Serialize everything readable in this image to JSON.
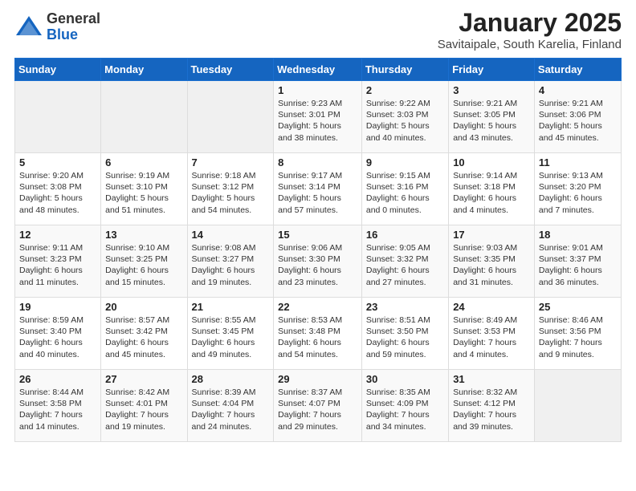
{
  "logo": {
    "general": "General",
    "blue": "Blue"
  },
  "header": {
    "title": "January 2025",
    "subtitle": "Savitaipale, South Karelia, Finland"
  },
  "weekdays": [
    "Sunday",
    "Monday",
    "Tuesday",
    "Wednesday",
    "Thursday",
    "Friday",
    "Saturday"
  ],
  "weeks": [
    [
      {
        "day": "",
        "info": ""
      },
      {
        "day": "",
        "info": ""
      },
      {
        "day": "",
        "info": ""
      },
      {
        "day": "1",
        "info": "Sunrise: 9:23 AM\nSunset: 3:01 PM\nDaylight: 5 hours and 38 minutes."
      },
      {
        "day": "2",
        "info": "Sunrise: 9:22 AM\nSunset: 3:03 PM\nDaylight: 5 hours and 40 minutes."
      },
      {
        "day": "3",
        "info": "Sunrise: 9:21 AM\nSunset: 3:05 PM\nDaylight: 5 hours and 43 minutes."
      },
      {
        "day": "4",
        "info": "Sunrise: 9:21 AM\nSunset: 3:06 PM\nDaylight: 5 hours and 45 minutes."
      }
    ],
    [
      {
        "day": "5",
        "info": "Sunrise: 9:20 AM\nSunset: 3:08 PM\nDaylight: 5 hours and 48 minutes."
      },
      {
        "day": "6",
        "info": "Sunrise: 9:19 AM\nSunset: 3:10 PM\nDaylight: 5 hours and 51 minutes."
      },
      {
        "day": "7",
        "info": "Sunrise: 9:18 AM\nSunset: 3:12 PM\nDaylight: 5 hours and 54 minutes."
      },
      {
        "day": "8",
        "info": "Sunrise: 9:17 AM\nSunset: 3:14 PM\nDaylight: 5 hours and 57 minutes."
      },
      {
        "day": "9",
        "info": "Sunrise: 9:15 AM\nSunset: 3:16 PM\nDaylight: 6 hours and 0 minutes."
      },
      {
        "day": "10",
        "info": "Sunrise: 9:14 AM\nSunset: 3:18 PM\nDaylight: 6 hours and 4 minutes."
      },
      {
        "day": "11",
        "info": "Sunrise: 9:13 AM\nSunset: 3:20 PM\nDaylight: 6 hours and 7 minutes."
      }
    ],
    [
      {
        "day": "12",
        "info": "Sunrise: 9:11 AM\nSunset: 3:23 PM\nDaylight: 6 hours and 11 minutes."
      },
      {
        "day": "13",
        "info": "Sunrise: 9:10 AM\nSunset: 3:25 PM\nDaylight: 6 hours and 15 minutes."
      },
      {
        "day": "14",
        "info": "Sunrise: 9:08 AM\nSunset: 3:27 PM\nDaylight: 6 hours and 19 minutes."
      },
      {
        "day": "15",
        "info": "Sunrise: 9:06 AM\nSunset: 3:30 PM\nDaylight: 6 hours and 23 minutes."
      },
      {
        "day": "16",
        "info": "Sunrise: 9:05 AM\nSunset: 3:32 PM\nDaylight: 6 hours and 27 minutes."
      },
      {
        "day": "17",
        "info": "Sunrise: 9:03 AM\nSunset: 3:35 PM\nDaylight: 6 hours and 31 minutes."
      },
      {
        "day": "18",
        "info": "Sunrise: 9:01 AM\nSunset: 3:37 PM\nDaylight: 6 hours and 36 minutes."
      }
    ],
    [
      {
        "day": "19",
        "info": "Sunrise: 8:59 AM\nSunset: 3:40 PM\nDaylight: 6 hours and 40 minutes."
      },
      {
        "day": "20",
        "info": "Sunrise: 8:57 AM\nSunset: 3:42 PM\nDaylight: 6 hours and 45 minutes."
      },
      {
        "day": "21",
        "info": "Sunrise: 8:55 AM\nSunset: 3:45 PM\nDaylight: 6 hours and 49 minutes."
      },
      {
        "day": "22",
        "info": "Sunrise: 8:53 AM\nSunset: 3:48 PM\nDaylight: 6 hours and 54 minutes."
      },
      {
        "day": "23",
        "info": "Sunrise: 8:51 AM\nSunset: 3:50 PM\nDaylight: 6 hours and 59 minutes."
      },
      {
        "day": "24",
        "info": "Sunrise: 8:49 AM\nSunset: 3:53 PM\nDaylight: 7 hours and 4 minutes."
      },
      {
        "day": "25",
        "info": "Sunrise: 8:46 AM\nSunset: 3:56 PM\nDaylight: 7 hours and 9 minutes."
      }
    ],
    [
      {
        "day": "26",
        "info": "Sunrise: 8:44 AM\nSunset: 3:58 PM\nDaylight: 7 hours and 14 minutes."
      },
      {
        "day": "27",
        "info": "Sunrise: 8:42 AM\nSunset: 4:01 PM\nDaylight: 7 hours and 19 minutes."
      },
      {
        "day": "28",
        "info": "Sunrise: 8:39 AM\nSunset: 4:04 PM\nDaylight: 7 hours and 24 minutes."
      },
      {
        "day": "29",
        "info": "Sunrise: 8:37 AM\nSunset: 4:07 PM\nDaylight: 7 hours and 29 minutes."
      },
      {
        "day": "30",
        "info": "Sunrise: 8:35 AM\nSunset: 4:09 PM\nDaylight: 7 hours and 34 minutes."
      },
      {
        "day": "31",
        "info": "Sunrise: 8:32 AM\nSunset: 4:12 PM\nDaylight: 7 hours and 39 minutes."
      },
      {
        "day": "",
        "info": ""
      }
    ]
  ]
}
